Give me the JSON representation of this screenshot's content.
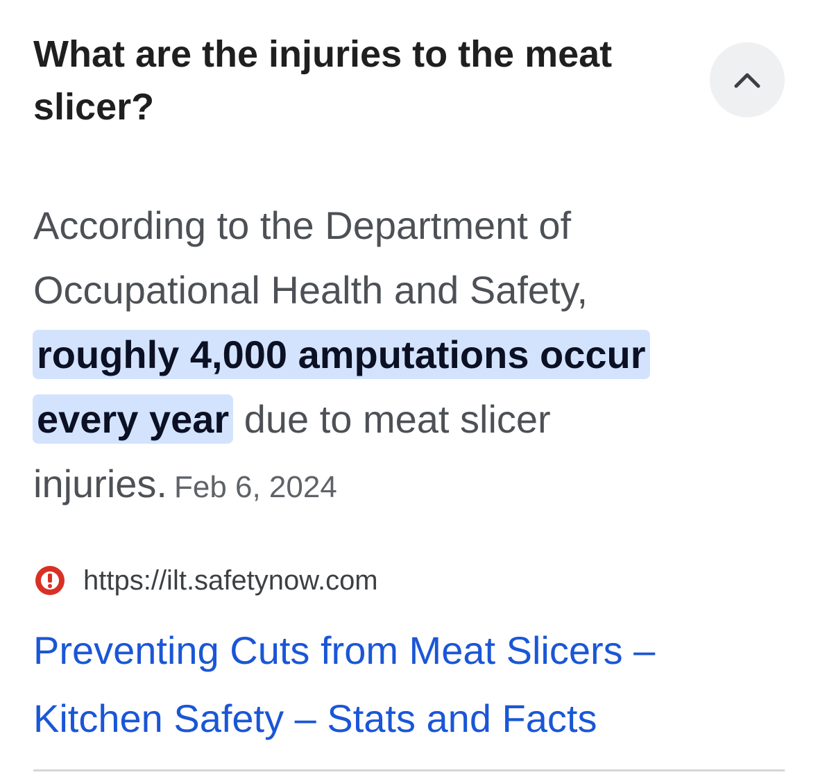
{
  "question": {
    "text": "What are the injuries to the meat slicer?",
    "toggle_icon": "chevron-up-icon"
  },
  "answer": {
    "before_highlight": "According to the Department of Occupational Health and Safety, ",
    "highlight": "roughly 4,000 amputations occur every year",
    "after_highlight": " due to meat slicer injuries.",
    "date": "Feb 6, 2024",
    "highlight_color": "#d3e3fd"
  },
  "source": {
    "favicon_icon": "alert-circle-icon",
    "favicon_color": "#d93025",
    "url": "https://ilt.safetynow.com"
  },
  "result": {
    "title": "Preventing Cuts from Meat Slicers – Kitchen Safety – Stats and Facts",
    "link_color": "#1a56d6"
  }
}
